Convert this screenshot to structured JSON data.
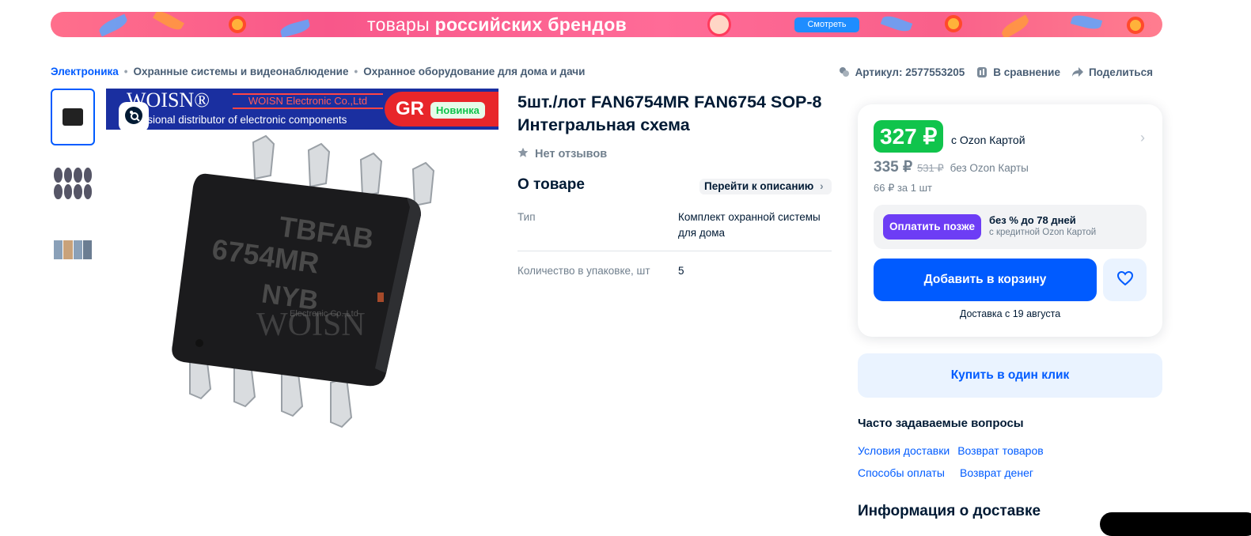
{
  "banner": {
    "text_light": "товары ",
    "text_bold": "российских брендов",
    "button_label": "Смотреть",
    "colors": {
      "background": "#f8578a",
      "button": "#1e8dff"
    }
  },
  "breadcrumbs": [
    {
      "label": "Электроника"
    },
    {
      "label": "Охранные системы и видеонаблюдение"
    },
    {
      "label": "Охранное оборудование для дома и дачи"
    }
  ],
  "toplinks": {
    "article": "Артикул: 2577553205",
    "compare": "В сравнение",
    "share": "Поделиться"
  },
  "gallery": {
    "thumb_icons": [
      "chip-thumbnail",
      "components-grid-thumbnail",
      "photo-strip-thumbnail"
    ],
    "image": {
      "brand": "WOISN®",
      "company": "WOISN Electronic Co.,Ltd",
      "tagline": "essional distributor of electronic components",
      "corner_text": "GR",
      "chip_line1": "TBFAB",
      "chip_line2": "6754MR",
      "chip_line3": "NYB",
      "watermark": "WOISN",
      "watermark_small": "Electronic Co.,Ltd"
    },
    "badge_new": "Новинка"
  },
  "product": {
    "title": "5шт./лот FAN6754MR FAN6754 SOP-8 Интегральная схема",
    "reviews": "Нет отзывов",
    "about_heading": "О товаре",
    "to_description": "Перейти к описанию",
    "props": [
      {
        "k": "Тип",
        "v": "Комплект охранной системы для дома"
      },
      {
        "k": "Количество в упаковке, шт",
        "v": "5"
      }
    ]
  },
  "buy": {
    "price_card": "327 ₽",
    "price_card_label": "с Ozon Картой",
    "price": "335 ₽",
    "price_old": "531 ₽",
    "price_label": "без Ozon Карты",
    "per_unit": "66 ₽ за 1 шт",
    "pay_later_button": "Оплатить позже",
    "pay_later_title": "без % до 78 дней",
    "pay_later_sub": "с кредитной Ozon Картой",
    "cart_button": "Добавить в корзину",
    "delivery": "Доставка с 19 августа",
    "one_click": "Купить в один клик",
    "colors": {
      "price_green": "#10c44c",
      "primary": "#005bff",
      "pay_later": "#6d3df5"
    }
  },
  "faq": {
    "heading": "Часто задаваемые вопросы",
    "links": [
      [
        "Условия доставки",
        "Возврат товаров"
      ],
      [
        "Способы оплаты",
        "Возврат денег"
      ]
    ]
  },
  "delivery_info_heading": "Информация о доставке"
}
